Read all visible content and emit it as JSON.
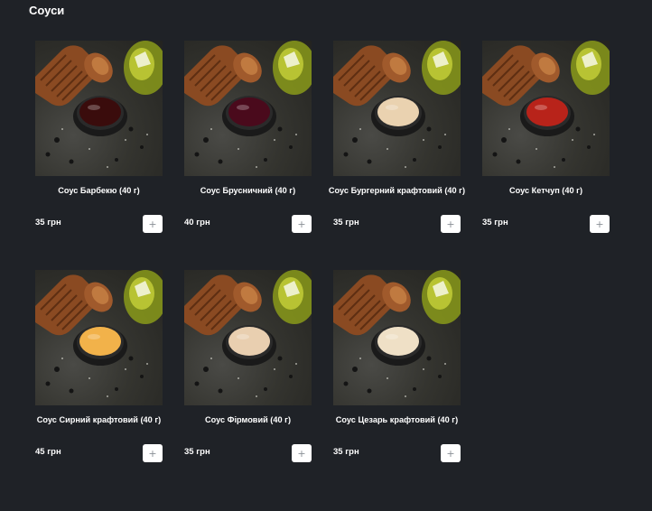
{
  "section": {
    "title": "Соуси"
  },
  "products": [
    {
      "name": "Соус Барбекю (40 г)",
      "price": "35 грн",
      "sauce_color": "#3a0c0c",
      "add_label": "+"
    },
    {
      "name": "Соус Брусничний (40 г)",
      "price": "40 грн",
      "sauce_color": "#4a0a1c",
      "add_label": "+"
    },
    {
      "name": "Соус Бургерний крафтовий (40 г)",
      "price": "35 грн",
      "sauce_color": "#ead2b0",
      "add_label": "+"
    },
    {
      "name": "Соус Кетчуп (40 г)",
      "price": "35 грн",
      "sauce_color": "#b8231a",
      "add_label": "+"
    },
    {
      "name": "Соус Сирний крафтовий (40 г)",
      "price": "45 грн",
      "sauce_color": "#f2b24a",
      "add_label": "+"
    },
    {
      "name": "Соус Фірмовий (40 г)",
      "price": "35 грн",
      "sauce_color": "#e9cfb0",
      "add_label": "+"
    },
    {
      "name": "Соус Цезарь крафтовий (40 г)",
      "price": "35 грн",
      "sauce_color": "#efe0c6",
      "add_label": "+"
    }
  ]
}
